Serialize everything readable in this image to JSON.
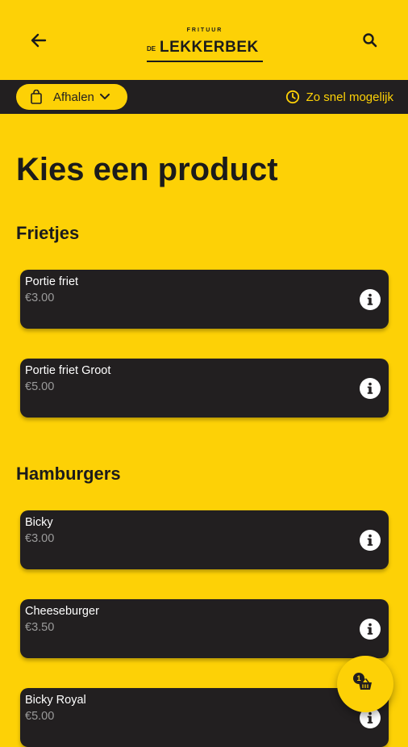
{
  "header": {
    "logo_small": "FRITUUR",
    "logo_de": "DE",
    "logo_main": "LEKKERBEK",
    "back_icon": "arrow-left-icon",
    "search_icon": "search-icon"
  },
  "bar": {
    "pickup_label": "Afhalen",
    "time_label": "Zo snel mogelijk"
  },
  "page": {
    "title": "Kies een product"
  },
  "sections": [
    {
      "title": "Frietjes",
      "products": [
        {
          "name": "Portie friet",
          "price": "€3.00"
        },
        {
          "name": "Portie friet Groot",
          "price": "€5.00"
        }
      ]
    },
    {
      "title": "Hamburgers",
      "products": [
        {
          "name": "Bicky",
          "price": "€3.00"
        },
        {
          "name": "Cheeseburger",
          "price": "€3.50"
        },
        {
          "name": "Bicky Royal",
          "price": "€5.00"
        }
      ]
    }
  ],
  "basket": {
    "count": "1",
    "icon": "basket-icon"
  },
  "colors": {
    "brand_yellow": "#FDD106",
    "dark": "#221F20",
    "price_gray": "#9b9b9b"
  }
}
